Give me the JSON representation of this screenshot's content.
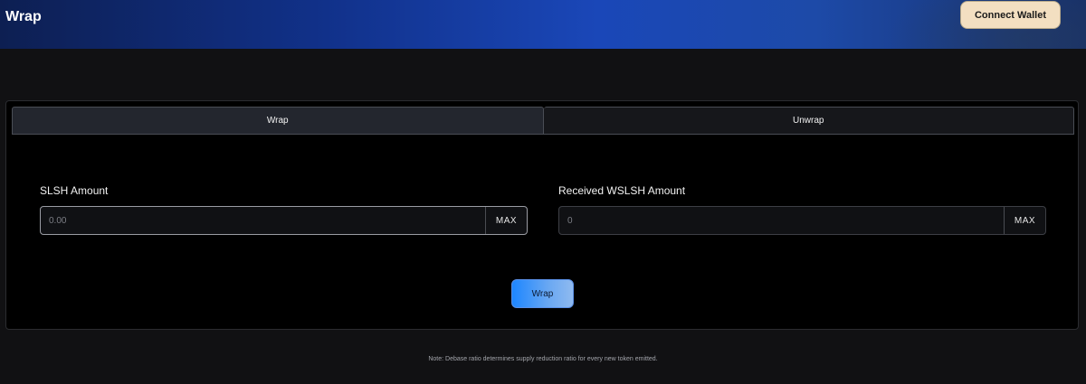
{
  "header": {
    "title": "Wrap",
    "connect_label": "Connect Wallet"
  },
  "tabs": [
    {
      "label": "Wrap",
      "active": true
    },
    {
      "label": "Unwrap",
      "active": false
    }
  ],
  "form": {
    "input_field": {
      "label": "SLSH Amount",
      "placeholder": "0.00",
      "max_label": "MAX"
    },
    "output_field": {
      "label": "Received WSLSH Amount",
      "placeholder": "0",
      "max_label": "MAX"
    },
    "submit_label": "Wrap"
  },
  "note": "Note: Debase ratio determines supply reduction ratio for every new token emitted.",
  "colors": {
    "accent": "#1d86ff",
    "connect_bg": "#f3dfc1",
    "page_bg": "#111113",
    "card_bg": "#000000"
  }
}
